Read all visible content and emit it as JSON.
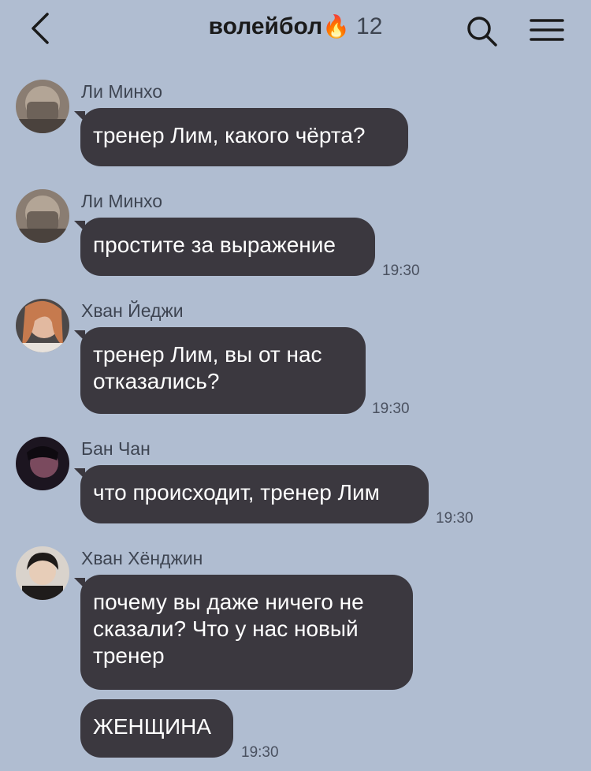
{
  "header": {
    "title": "волейбол",
    "emoji": "🔥",
    "member_count": "12",
    "icons": [
      "chevron-left-icon",
      "search-icon",
      "menu-icon"
    ]
  },
  "messages": [
    {
      "sender": "Ли Минхо",
      "text": "тренер Лим, какого чёрта?",
      "time": ""
    },
    {
      "sender": "Ли Минхо",
      "text": "простите за выражение",
      "time": "19:30"
    },
    {
      "sender": "Хван Йеджи",
      "text_line1": "тренер Лим, вы от нас",
      "text_line2": "отказались?",
      "time": "19:30"
    },
    {
      "sender": "Бан Чан",
      "text": "что происходит, тренер Лим",
      "time": "19:30"
    },
    {
      "sender": "Хван Хёнджин",
      "text_line1": "почему вы даже ничего не",
      "text_line2": "сказали? Что у нас новый",
      "text_line3": "тренер",
      "time": ""
    },
    {
      "sender": "",
      "text": "ЖЕНЩИНА",
      "time": "19:30"
    }
  ],
  "colors": {
    "background": "#b0bdd1",
    "bubble": "#3b383f",
    "bubble_text": "#ffffff"
  }
}
